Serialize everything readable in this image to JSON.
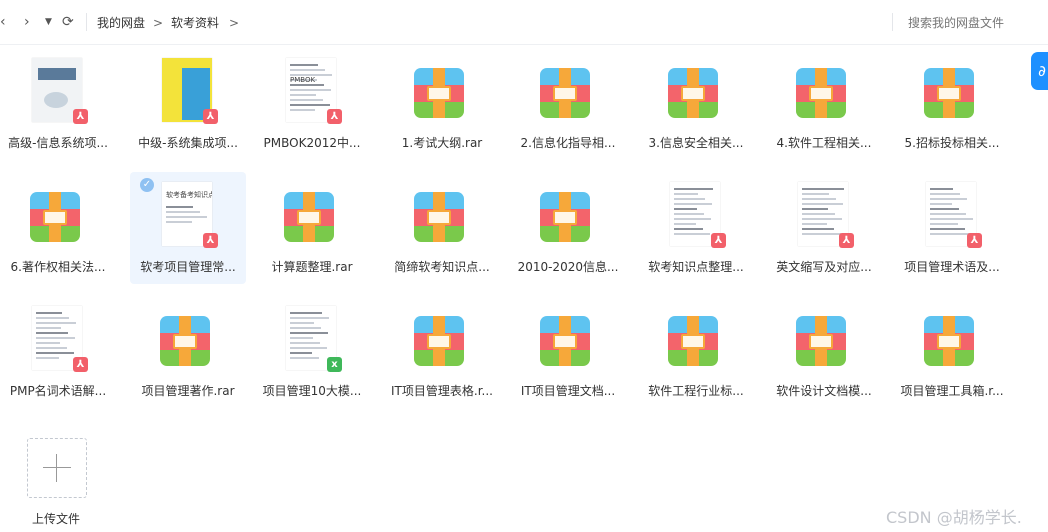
{
  "toolbar": {
    "back_icon": "chevron-left-icon",
    "forward_icon": "chevron-right-icon",
    "history_icon": "caret-down-icon",
    "refresh_icon": "refresh-icon"
  },
  "breadcrumb": [
    "我的网盘",
    "软考资料"
  ],
  "search": {
    "placeholder": "搜索我的网盘文件"
  },
  "side_button_icon": "link-icon",
  "files": [
    {
      "name": "高级-信息系统项...",
      "type": "pdf"
    },
    {
      "name": "中级-系统集成项...",
      "type": "pdf"
    },
    {
      "name": "PMBOK2012中...",
      "type": "pdf"
    },
    {
      "name": "1.考试大纲.rar",
      "type": "rar"
    },
    {
      "name": "2.信息化指导相...",
      "type": "rar"
    },
    {
      "name": "3.信息安全相关...",
      "type": "rar"
    },
    {
      "name": "4.软件工程相关...",
      "type": "rar"
    },
    {
      "name": "5.招标投标相关...",
      "type": "rar"
    },
    {
      "name": "6.著作权相关法...",
      "type": "rar"
    },
    {
      "name": "软考项目管理常...",
      "type": "pdf",
      "selected": true
    },
    {
      "name": "计算题整理.rar",
      "type": "rar"
    },
    {
      "name": "简缔软考知识点...",
      "type": "rar"
    },
    {
      "name": "2010-2020信息...",
      "type": "rar"
    },
    {
      "name": "软考知识点整理...",
      "type": "pdf"
    },
    {
      "name": "英文缩写及对应...",
      "type": "pdf"
    },
    {
      "name": "项目管理术语及...",
      "type": "pdf"
    },
    {
      "name": "PMP名词术语解...",
      "type": "pdf"
    },
    {
      "name": "项目管理著作.rar",
      "type": "rar"
    },
    {
      "name": "项目管理10大模...",
      "type": "xls"
    },
    {
      "name": "IT项目管理表格.r...",
      "type": "rar"
    },
    {
      "name": "IT项目管理文档...",
      "type": "rar"
    },
    {
      "name": "软件工程行业标...",
      "type": "rar"
    },
    {
      "name": "软件设计文档模...",
      "type": "rar"
    },
    {
      "name": "项目管理工具箱.r...",
      "type": "rar"
    }
  ],
  "doc_cover_texts": {
    "cover_2": "PMBOK",
    "cover_9": "软考备考知识点"
  },
  "upload": {
    "label": "上传文件"
  },
  "watermark": "CSDN @胡杨学长."
}
